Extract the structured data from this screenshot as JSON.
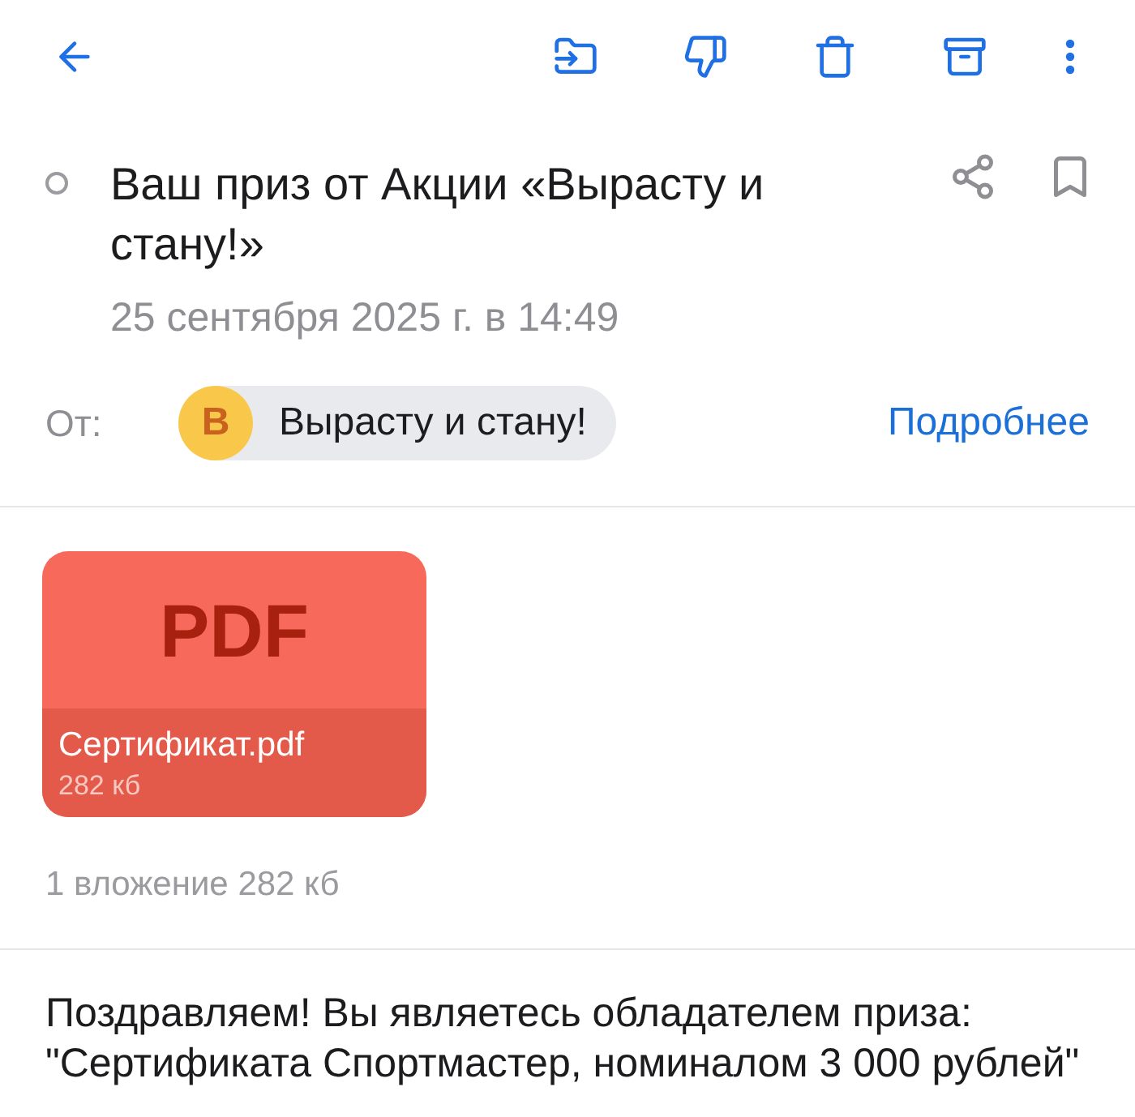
{
  "message": {
    "title": "Ваш приз от Акции «Вырасту и стану!»",
    "unread": false,
    "bookmarked": false,
    "date": "25 сентября 2025 г. в 14:49"
  },
  "sender": {
    "label": "От:",
    "initial": "В",
    "name": "Вырасту и стану!",
    "details_link": "Подробнее"
  },
  "attachments": [
    {
      "type": "PDF",
      "name": "Сертификат.pdf",
      "size": "282 кб"
    }
  ],
  "attachments_summary": "1 вложение 282 кб",
  "body": [
    "Поздравляем! Вы являетесь обладателем приза:",
    "\"Сертификата Спортмастер, номиналом 3 000 рублей\""
  ]
}
